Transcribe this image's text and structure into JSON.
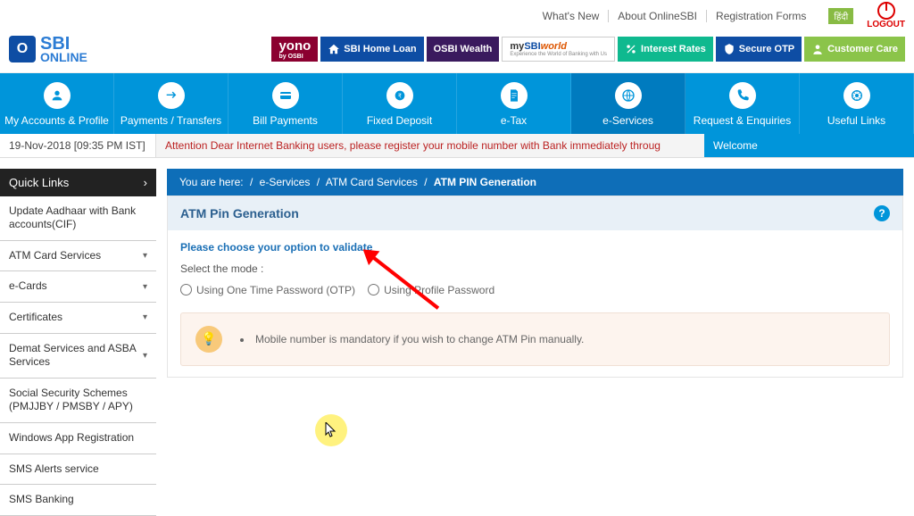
{
  "top_links": [
    "What's New",
    "About OnlineSBI",
    "Registration Forms"
  ],
  "hindi_label": "हिंदी",
  "logout": "LOGOUT",
  "logo": {
    "line1": "SBI",
    "line2": "ONLINE",
    "badge": "O"
  },
  "header_tiles": {
    "yono": "yono",
    "yono_sub": "by OSBI",
    "home": "SBI Home Loan",
    "wealth": "OSBI Wealth",
    "world_my": "my",
    "world_sbi": "SBI",
    "world_world": "world",
    "world_tag": "Experience the World of Banking with Us",
    "interest": "Interest Rates",
    "secure": "Secure OTP",
    "care": "Customer Care"
  },
  "nav": [
    "My Accounts & Profile",
    "Payments / Transfers",
    "Bill Payments",
    "Fixed Deposit",
    "e-Tax",
    "e-Services",
    "Request & Enquiries",
    "Useful Links"
  ],
  "nav_active_index": 5,
  "timestamp": "19-Nov-2018 [09:35 PM IST]",
  "marquee": "Attention Dear Internet Banking users, please register your mobile number with Bank immediately throug",
  "welcome": "Welcome",
  "sidebar_header": "Quick Links",
  "sidebar": [
    {
      "label": "Update Aadhaar with Bank accounts(CIF)",
      "caret": false
    },
    {
      "label": "ATM Card Services",
      "caret": true
    },
    {
      "label": "e-Cards",
      "caret": true
    },
    {
      "label": "Certificates",
      "caret": true
    },
    {
      "label": "Demat Services and ASBA Services",
      "caret": true
    },
    {
      "label": "Social Security Schemes (PMJJBY / PMSBY / APY)",
      "caret": false
    },
    {
      "label": "Windows App Registration",
      "caret": false
    },
    {
      "label": "SMS Alerts service",
      "caret": false
    },
    {
      "label": "SMS Banking",
      "caret": false
    }
  ],
  "breadcrumb": {
    "prefix": "You are here:",
    "items": [
      "e-Services",
      "ATM Card Services",
      "ATM PIN Generation"
    ]
  },
  "panel": {
    "title": "ATM Pin Generation",
    "subhead": "Please choose your option to validate",
    "mode_label": "Select the mode :",
    "radios": [
      "Using One Time Password (OTP)",
      "Using Profile Password"
    ],
    "info_bullet": "Mobile number is mandatory if you wish to change ATM Pin manually."
  }
}
